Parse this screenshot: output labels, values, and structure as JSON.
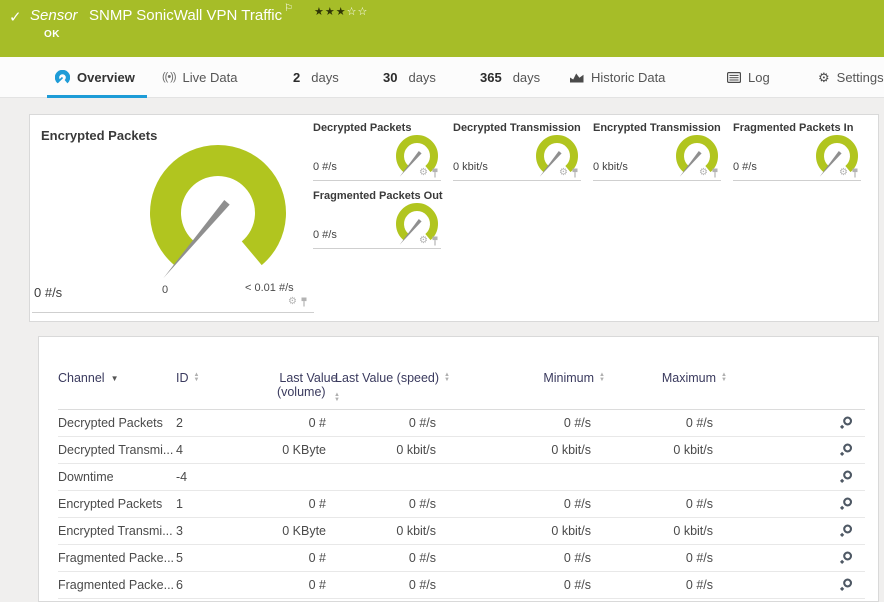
{
  "colors": {
    "brand_green": "#a6bd28",
    "gauge_green": "#b1c51f",
    "accent_blue": "#1e9cd7"
  },
  "header": {
    "check": "✓",
    "type_label": "Sensor",
    "title": "SNMP SonicWall VPN Traffic",
    "flag": "⚐",
    "stars_filled": "★★★",
    "stars_empty": "☆☆",
    "status": "OK"
  },
  "tabs": [
    {
      "label": "Overview"
    },
    {
      "label": "Live Data"
    },
    {
      "num": "2",
      "label": "days"
    },
    {
      "num": "30",
      "label": "days"
    },
    {
      "num": "365",
      "label": "days"
    },
    {
      "label": "Historic Data"
    },
    {
      "label": "Log"
    },
    {
      "label": "Settings"
    }
  ],
  "gauges": {
    "primary": {
      "title": "Encrypted Packets",
      "value": "0 #/s",
      "scale_min": "0",
      "scale_max": "< 0.01 #/s"
    },
    "small": [
      {
        "title": "Decrypted Packets",
        "value": "0 #/s"
      },
      {
        "title": "Decrypted Transmission",
        "value": "0 kbit/s"
      },
      {
        "title": "Encrypted Transmission",
        "value": "0 kbit/s"
      },
      {
        "title": "Fragmented Packets In",
        "value": "0 #/s"
      },
      {
        "title": "Fragmented Packets Out",
        "value": "0 #/s"
      }
    ]
  },
  "table": {
    "headers": {
      "channel": "Channel",
      "id": "ID",
      "volume_line1": "Last Value",
      "volume_line2": "(volume)",
      "speed": "Last Value (speed)",
      "minimum": "Minimum",
      "maximum": "Maximum"
    },
    "rows": [
      {
        "channel": "Decrypted Packets",
        "id": "2",
        "volume": "0 #",
        "speed": "0 #/s",
        "min": "0 #/s",
        "max": "0 #/s"
      },
      {
        "channel": "Decrypted Transmi...",
        "id": "4",
        "volume": "0 KByte",
        "speed": "0 kbit/s",
        "min": "0 kbit/s",
        "max": "0 kbit/s"
      },
      {
        "channel": "Downtime",
        "id": "-4",
        "volume": "",
        "speed": "",
        "min": "",
        "max": ""
      },
      {
        "channel": "Encrypted Packets",
        "id": "1",
        "volume": "0 #",
        "speed": "0 #/s",
        "min": "0 #/s",
        "max": "0 #/s"
      },
      {
        "channel": "Encrypted Transmi...",
        "id": "3",
        "volume": "0 KByte",
        "speed": "0 kbit/s",
        "min": "0 kbit/s",
        "max": "0 kbit/s"
      },
      {
        "channel": "Fragmented Packe...",
        "id": "5",
        "volume": "0 #",
        "speed": "0 #/s",
        "min": "0 #/s",
        "max": "0 #/s"
      },
      {
        "channel": "Fragmented Packe...",
        "id": "6",
        "volume": "0 #",
        "speed": "0 #/s",
        "min": "0 #/s",
        "max": "0 #/s"
      }
    ]
  }
}
